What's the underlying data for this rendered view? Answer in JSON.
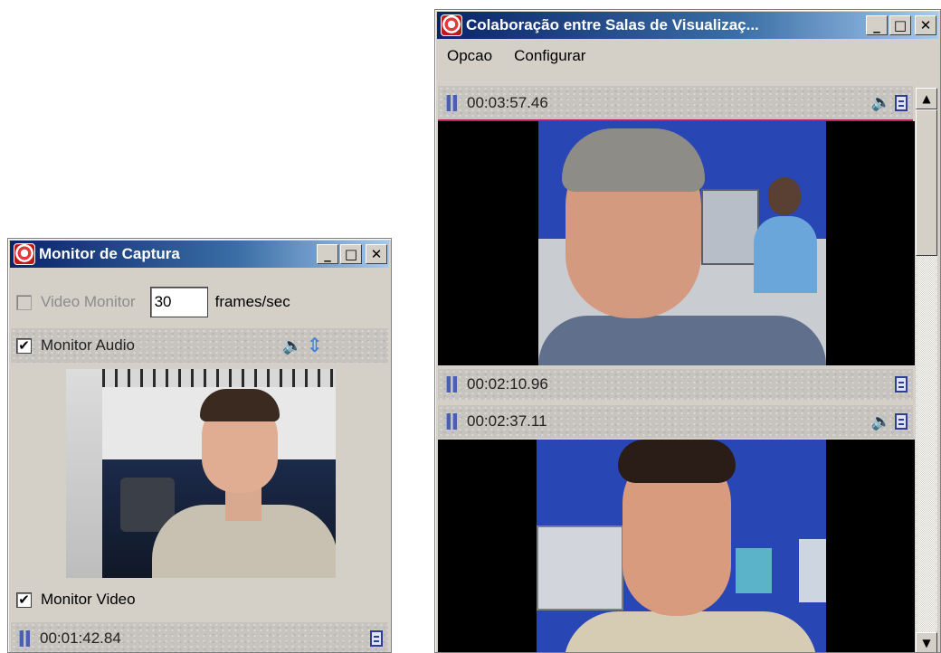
{
  "monitor_window": {
    "title": "Monitor de Captura",
    "video_monitor_label": "Video Monitor",
    "fps_value": "30",
    "fps_unit": "frames/sec",
    "monitor_audio_label": "Monitor Audio",
    "monitor_video_label": "Monitor Video",
    "monitor_audio_checked": "✔",
    "monitor_video_checked": "✔",
    "time": "00:01:42.84"
  },
  "collab_window": {
    "title": "Colaboração entre Salas de Visualizaç...",
    "menu": [
      "Opcao",
      "Configurar"
    ],
    "streams": [
      {
        "time": "00:03:57.46"
      },
      {
        "time": "00:02:10.96"
      },
      {
        "time": "00:02:37.11"
      }
    ]
  },
  "window_buttons": {
    "minimize": "_",
    "maximize": "□",
    "close": "✕"
  },
  "scroll_arrows": {
    "up": "▲",
    "down": "▼"
  },
  "icons": {
    "speaker": "🔉",
    "updown": "⇕"
  },
  "colors": {
    "title_start": "#0a246a",
    "title_end": "#a6caf0",
    "window_bg": "#d4d0c8",
    "room_wall": "#2846b4"
  }
}
